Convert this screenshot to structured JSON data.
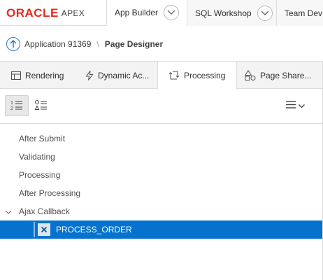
{
  "header": {
    "logo": {
      "brand": "ORACLE",
      "product": "APEX"
    },
    "tabs": [
      {
        "label": "App Builder"
      },
      {
        "label": "SQL Workshop"
      },
      {
        "label": "Team Dev"
      }
    ]
  },
  "breadcrumb": {
    "parent": "Application 91369",
    "separator": "\\",
    "current": "Page Designer"
  },
  "subtabs": [
    {
      "label": "Rendering",
      "icon": "rendering-icon"
    },
    {
      "label": "Dynamic Ac...",
      "icon": "lightning-icon"
    },
    {
      "label": "Processing",
      "icon": "processing-icon"
    },
    {
      "label": "Page Share...",
      "icon": "shapes-icon"
    }
  ],
  "toolbar": {
    "views": [
      "ordered-list-icon",
      "grouped-list-icon"
    ],
    "menu_icon": "hamburger-menu-icon"
  },
  "tree": {
    "items": [
      {
        "label": "After Submit"
      },
      {
        "label": "Validating"
      },
      {
        "label": "Processing"
      },
      {
        "label": "After Processing"
      },
      {
        "label": "Ajax Callback"
      },
      {
        "label": "PROCESS_ORDER"
      }
    ]
  },
  "colors": {
    "oracle_red": "#e52b1e",
    "selection_blue": "#0572ce",
    "link_blue": "#2a79c2"
  }
}
